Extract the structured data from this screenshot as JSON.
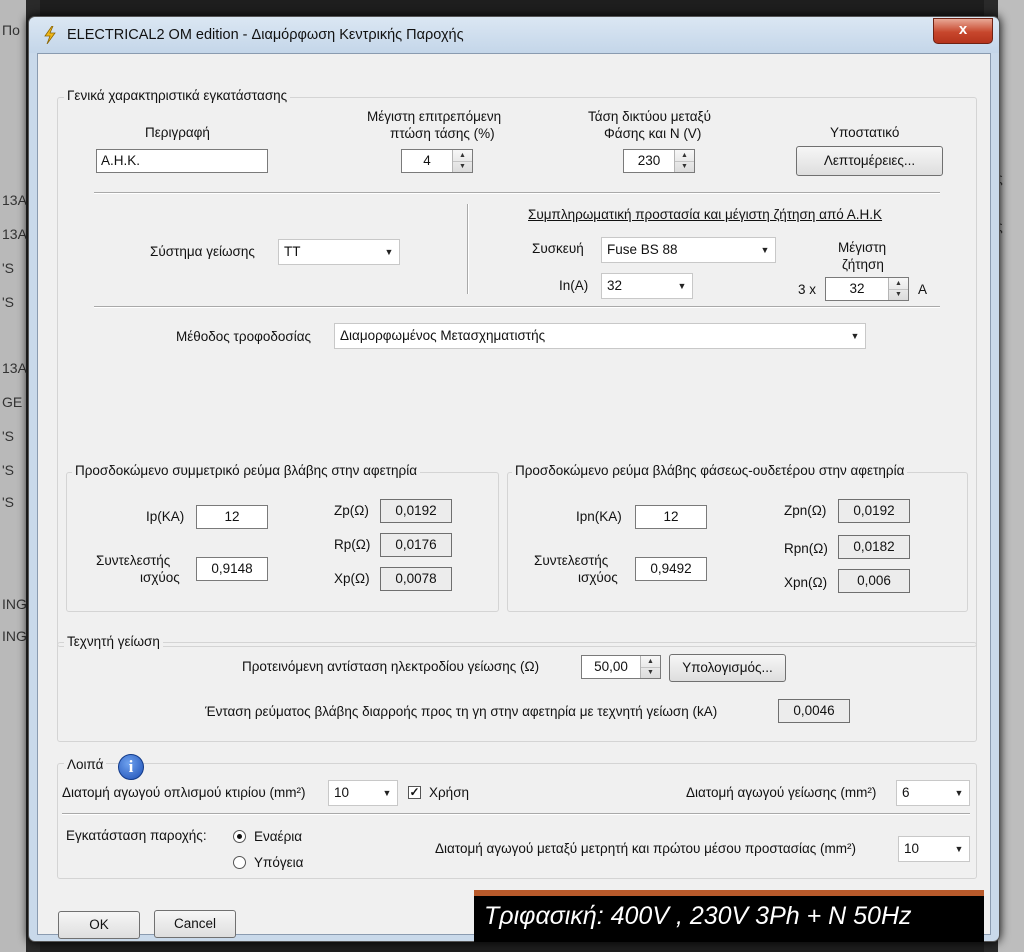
{
  "background": {
    "left_fragments": [
      "Πο",
      "13A",
      "13A",
      "'S",
      "'S",
      "13A",
      "GE",
      "'S",
      "'S",
      "'S",
      "ING",
      "ING"
    ],
    "right_fragments": [
      "ς",
      "ς"
    ]
  },
  "window": {
    "title": "ELECTRICAL2 OM edition - Διαμόρφωση Κεντρικής Παροχής",
    "close_label": "x"
  },
  "general": {
    "legend": "Γενικά χαρακτηριστικά εγκατάστασης",
    "description": {
      "label": "Περιγραφή",
      "value": "Α.Η.Κ."
    },
    "max_voltage_drop": {
      "label_line1": "Μέγιστη επιτρεπόμενη",
      "label_line2": "πτώση τάσης (%)",
      "value": "4"
    },
    "network_voltage": {
      "label_line1": "Τάση δικτύου μεταξύ",
      "label_line2": "Φάσης και Ν (V)",
      "value": "230"
    },
    "substation": {
      "label": "Υποστατικό",
      "button": "Λεπτομέρειες..."
    },
    "earthing_system": {
      "label": "Σύστημα γείωσης",
      "value": "TT"
    },
    "protection": {
      "title": "Συμπληρωματική προστασία και μέγιστη ζήτηση από Α.Η.Κ",
      "device_label": "Συσκευή",
      "device_value": "Fuse BS 88",
      "in_label": "In(A)",
      "in_value": "32",
      "max_demand_label_line1": "Μέγιστη",
      "max_demand_label_line2": "ζήτηση",
      "max_demand_prefix": "3 x",
      "max_demand_value": "32",
      "max_demand_unit": "A"
    },
    "supply_method": {
      "label": "Μέθοδος τροφοδοσίας",
      "value": "Διαμορφωμένος Μετασχηματιστής"
    }
  },
  "symmetric_fault": {
    "legend": "Προσδοκώμενο συμμετρικό ρεύμα βλάβης στην αφετηρία",
    "ip_label": "Ip(KA)",
    "ip_value": "12",
    "pf_label_line1": "Συντελεστής",
    "pf_label_line2": "ισχύος",
    "pf_value": "0,9148",
    "zp_label": "Zp(Ω)",
    "zp_value": "0,0192",
    "rp_label": "Rp(Ω)",
    "rp_value": "0,0176",
    "xp_label": "Xp(Ω)",
    "xp_value": "0,0078"
  },
  "neutral_fault": {
    "legend": "Προσδοκώμενο ρεύμα βλάβης φάσεως-ουδετέρου στην αφετηρία",
    "ipn_label": "Ipn(KA)",
    "ipn_value": "12",
    "pf_label_line1": "Συντελεστής",
    "pf_label_line2": "ισχύος",
    "pf_value": "0,9492",
    "zpn_label": "Zpn(Ω)",
    "zpn_value": "0,0192",
    "rpn_label": "Rpn(Ω)",
    "rpn_value": "0,0182",
    "xpn_label": "Xpn(Ω)",
    "xpn_value": "0,006"
  },
  "artificial_earth": {
    "legend": "Τεχνητή γείωση",
    "electrode_label": "Προτεινόμενη αντίσταση ηλεκτροδίου γείωσης (Ω)",
    "electrode_value": "50,00",
    "calc_button": "Υπολογισμός...",
    "leak_label": "Ένταση ρεύματος βλάβης διαρροής προς τη γη στην αφετηρία με τεχνητή γείωση (kA)",
    "leak_value": "0,0046"
  },
  "other": {
    "legend": "Λοιπά",
    "building_conductor_label": "Διατομή αγωγού οπλισμού κτιρίου (mm²)",
    "building_conductor_value": "10",
    "use_label": "Χρήση",
    "use_checked": "✓",
    "earth_conductor_label": "Διατομή αγωγού γείωσης (mm²)",
    "earth_conductor_value": "6",
    "install_label": "Εγκατάσταση παροχής:",
    "aerial_label": "Εναέρια",
    "underground_label": "Υπόγεια",
    "meter_conductor_label": "Διατομή αγωγού μεταξύ μετρητή και πρώτου μέσου προστασίας (mm²)",
    "meter_conductor_value": "10"
  },
  "footer": {
    "ok": "OK",
    "cancel": "Cancel",
    "banner": "Τριφασική: 400V , 230V 3Ph + N 50Hz"
  },
  "colors": {
    "banner_bar": "#b85a2b",
    "close_button": "#c7472d"
  }
}
